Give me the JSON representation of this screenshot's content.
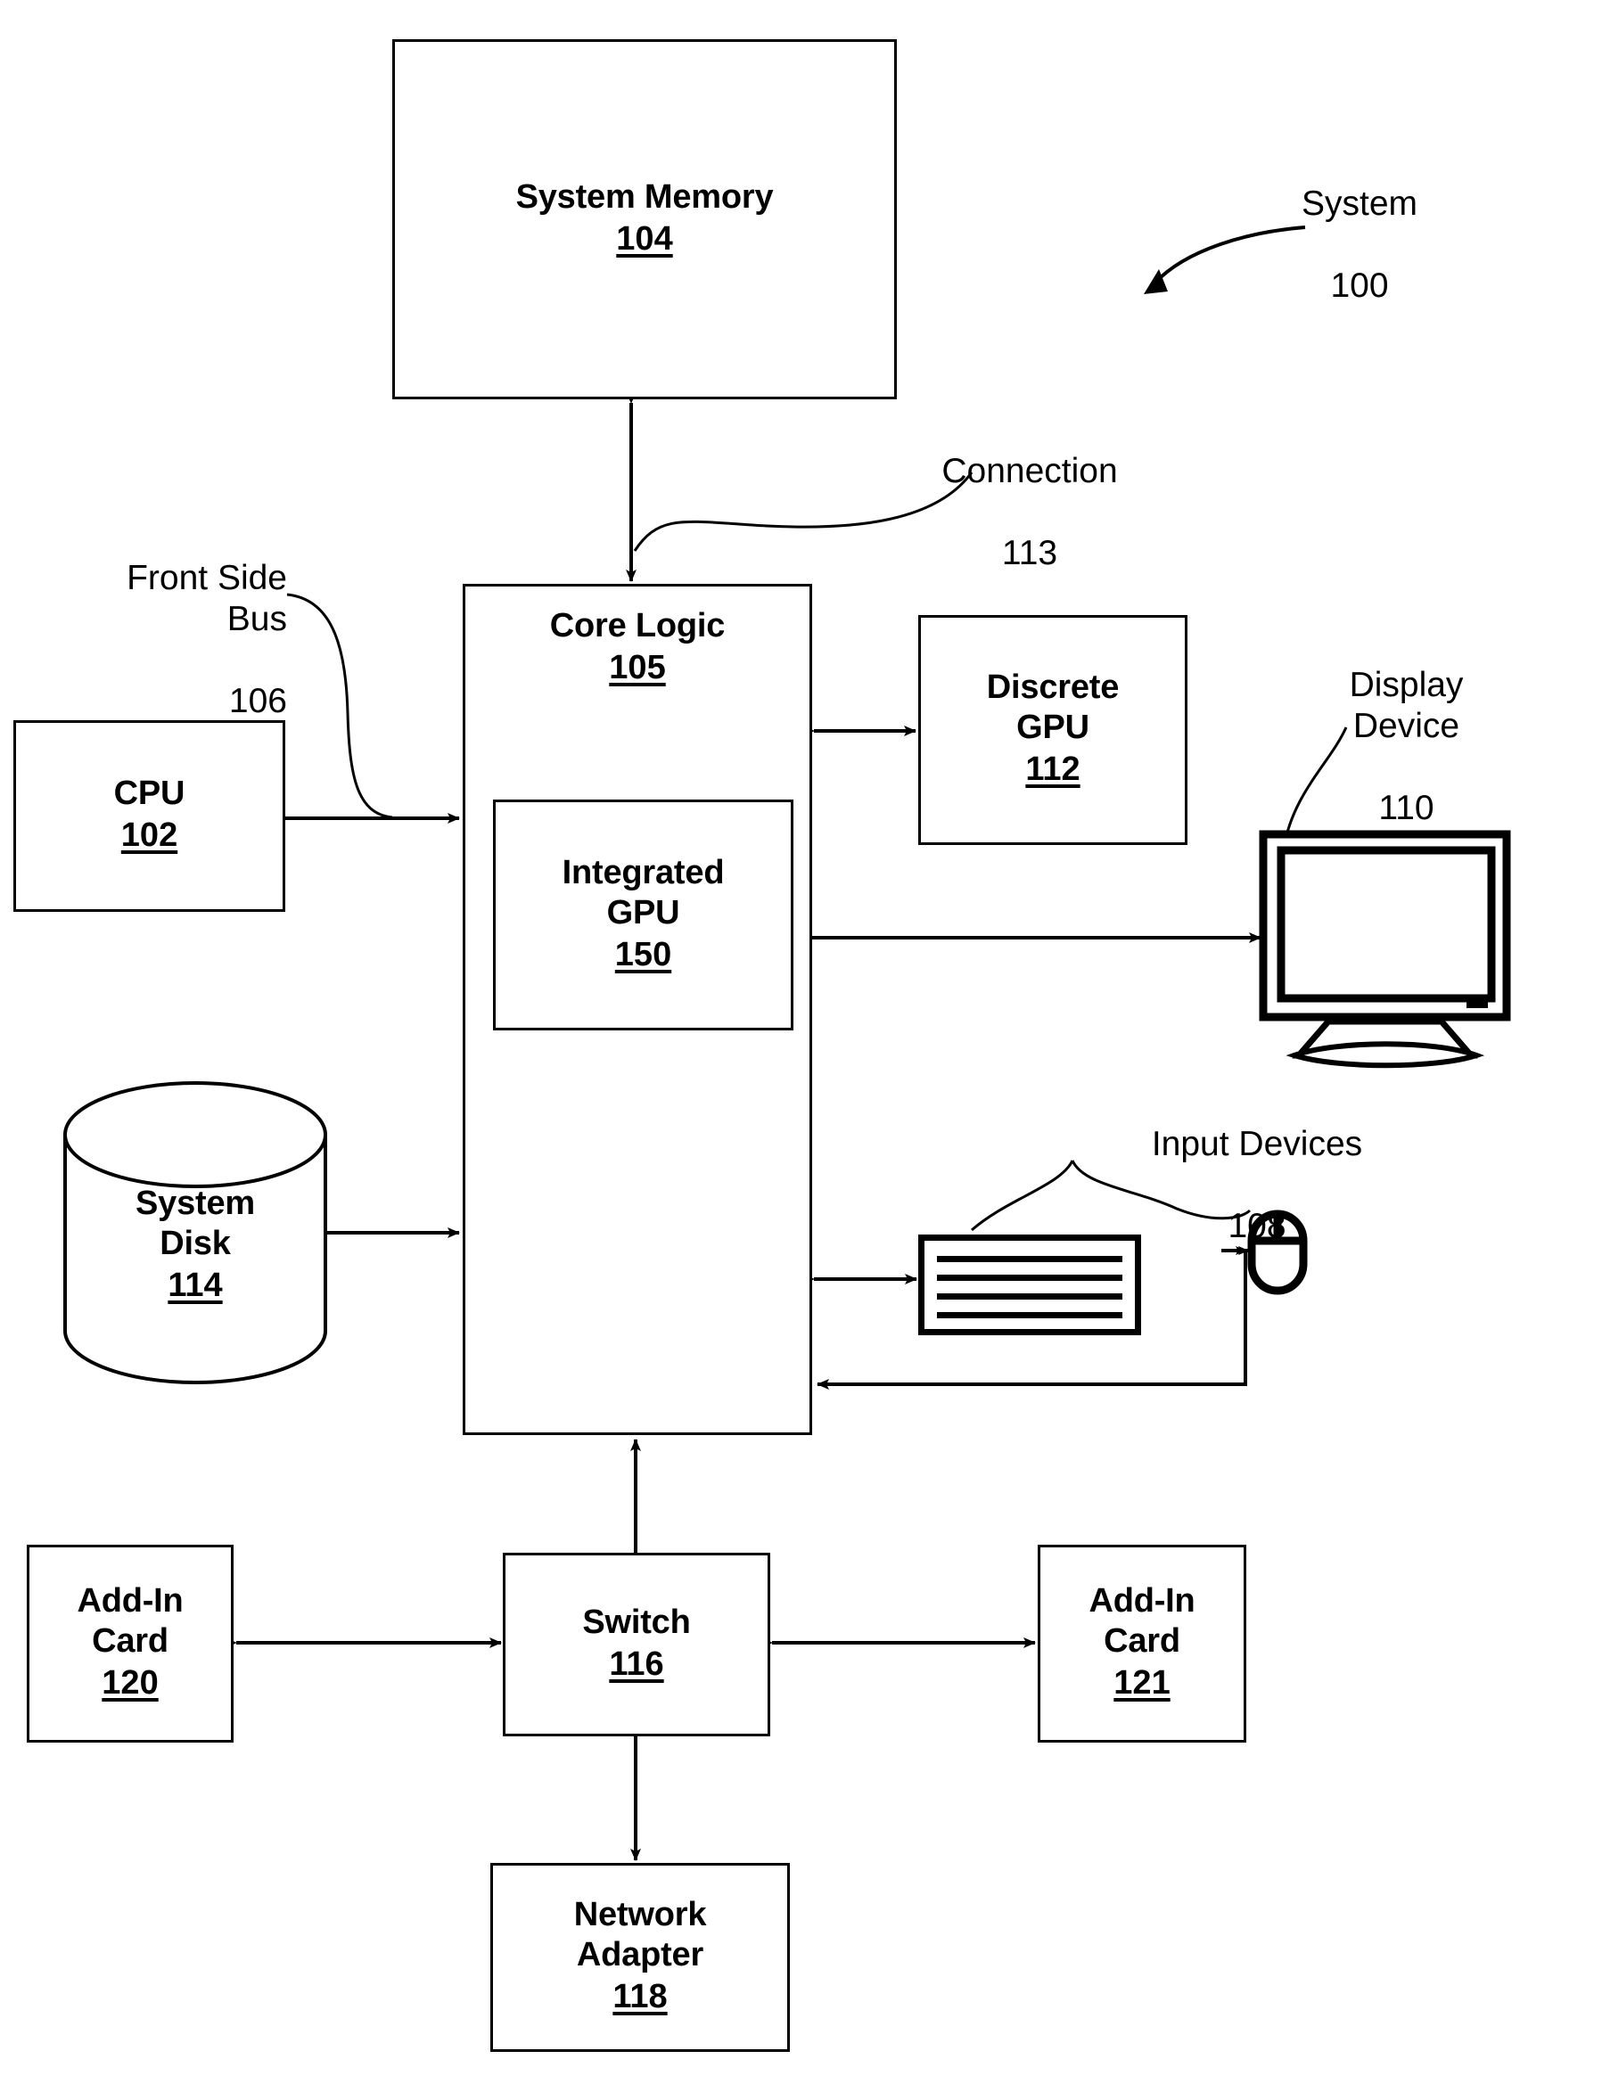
{
  "figure": {
    "title": "System 100",
    "system_label": "System",
    "system_ref": "100"
  },
  "blocks": [
    {
      "id": "system_memory",
      "label": "System Memory",
      "ref": "104"
    },
    {
      "id": "core_logic",
      "label": "Core Logic",
      "ref": "105"
    },
    {
      "id": "integrated_gpu",
      "label": "Integrated\nGPU",
      "ref": "150"
    },
    {
      "id": "cpu",
      "label": "CPU",
      "ref": "102"
    },
    {
      "id": "discrete_gpu",
      "label": "Discrete\nGPU",
      "ref": "112"
    },
    {
      "id": "system_disk",
      "label": "System\nDisk",
      "ref": "114"
    },
    {
      "id": "switch",
      "label": "Switch",
      "ref": "116"
    },
    {
      "id": "add_in_card_120",
      "label": "Add-In\nCard",
      "ref": "120"
    },
    {
      "id": "add_in_card_121",
      "label": "Add-In\nCard",
      "ref": "121"
    },
    {
      "id": "network_adapter",
      "label": "Network\nAdapter",
      "ref": "118"
    }
  ],
  "callouts": [
    {
      "id": "connection",
      "label": "Connection",
      "ref": "113"
    },
    {
      "id": "front_side_bus",
      "label": "Front Side\nBus",
      "ref": "106"
    },
    {
      "id": "display_device",
      "label": "Display\nDevice",
      "ref": "110"
    },
    {
      "id": "input_devices",
      "label": "Input Devices",
      "ref": "108"
    }
  ],
  "icons": {
    "display": "monitor-icon",
    "keyboard": "keyboard-icon",
    "mouse": "mouse-icon",
    "disk": "cylinder-disk-icon"
  },
  "colors": {
    "stroke": "#000000",
    "fill": "#ffffff"
  }
}
